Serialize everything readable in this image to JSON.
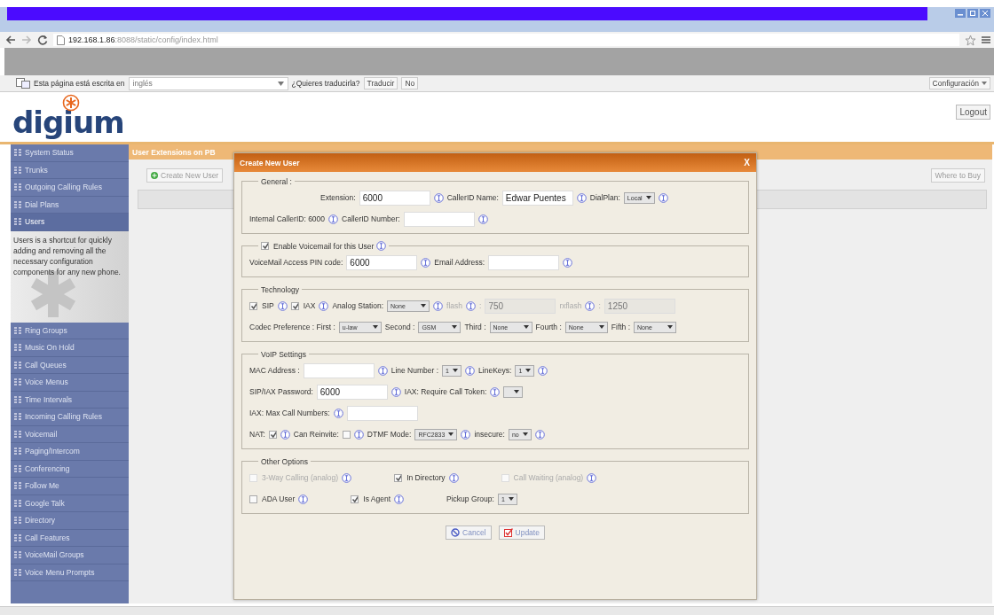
{
  "browser": {
    "url_host": "192.168.1.86",
    "url_rest": ":8088/static/config/index.html"
  },
  "translate_bar": {
    "prefix": "Esta página está escrita en",
    "language": "inglés",
    "question": "¿Quieres traducirla?",
    "buttons": [
      "Traducir",
      "No"
    ],
    "settings": "Configuración"
  },
  "header": {
    "logo": "digium",
    "logout": "Logout"
  },
  "sidebar": {
    "items_top": [
      {
        "label": "System Status",
        "selected": false
      },
      {
        "label": "Trunks",
        "selected": false
      },
      {
        "label": "Outgoing Calling Rules",
        "selected": false
      },
      {
        "label": "Dial Plans",
        "selected": false
      },
      {
        "label": "Users",
        "selected": true
      }
    ],
    "description": "Users is a shortcut for quickly adding and removing all the necessary configuration components for any new phone.",
    "items_bottom": [
      {
        "label": "Ring Groups",
        "selected": false
      },
      {
        "label": "Music On Hold",
        "selected": false
      },
      {
        "label": "Call Queues",
        "selected": false
      },
      {
        "label": "Voice Menus",
        "selected": false
      },
      {
        "label": "Time Intervals",
        "selected": false
      },
      {
        "label": "Incoming Calling Rules",
        "selected": false
      },
      {
        "label": "Voicemail",
        "selected": false
      },
      {
        "label": "Paging/Intercom",
        "selected": false
      },
      {
        "label": "Conferencing",
        "selected": false
      },
      {
        "label": "Follow Me",
        "selected": false
      },
      {
        "label": "Google Talk",
        "selected": false
      },
      {
        "label": "Directory",
        "selected": false
      },
      {
        "label": "Call Features",
        "selected": false
      },
      {
        "label": "VoiceMail Groups",
        "selected": false
      },
      {
        "label": "Voice Menu Prompts",
        "selected": false
      }
    ]
  },
  "page": {
    "title": "User Extensions on PB",
    "create_button": "Create New User",
    "where_button": "Where to Buy"
  },
  "dialog": {
    "title": "Create New User",
    "close": "X",
    "sections": [
      {
        "legend": [
          {
            "kind": "label",
            "text": "General :"
          }
        ],
        "rows": [
          {
            "items": [
              {
                "kind": "label",
                "text": "Extension:"
              },
              {
                "kind": "input",
                "value": "6000",
                "disabled": false
              },
              {
                "kind": "info"
              },
              {
                "kind": "label",
                "text": "CallerID Name:"
              },
              {
                "kind": "input",
                "value": "Edwar Puentes",
                "disabled": false
              },
              {
                "kind": "info"
              },
              {
                "kind": "label",
                "text": "DialPlan:"
              },
              {
                "kind": "select",
                "value": "Local"
              },
              {
                "kind": "info"
              }
            ]
          },
          {
            "items": [
              {
                "kind": "label",
                "text": "Internal CallerID: 6000"
              },
              {
                "kind": "info"
              },
              {
                "kind": "label",
                "text": "CallerID Number:"
              },
              {
                "kind": "input",
                "disabled": false
              },
              {
                "kind": "info"
              }
            ]
          }
        ]
      },
      {
        "legend": [
          {
            "kind": "checkbox",
            "label": "Enable Voicemail for this User",
            "checked": true,
            "disabled": false
          },
          {
            "kind": "info"
          }
        ],
        "rows": [
          {
            "items": [
              {
                "kind": "label",
                "text": "VoiceMail Access PIN code:"
              },
              {
                "kind": "input",
                "value": "6000",
                "disabled": false
              },
              {
                "kind": "info"
              },
              {
                "kind": "label",
                "text": "Email Address:"
              },
              {
                "kind": "input",
                "disabled": false
              },
              {
                "kind": "info"
              }
            ]
          }
        ]
      },
      {
        "legend": [
          {
            "kind": "label",
            "text": "Technology"
          }
        ],
        "rows": [
          {
            "items": [
              {
                "kind": "checkbox",
                "label": "SIP",
                "checked": true,
                "disabled": false
              },
              {
                "kind": "info"
              },
              {
                "kind": "checkbox",
                "label": "IAX",
                "checked": true,
                "disabled": false
              },
              {
                "kind": "info"
              },
              {
                "kind": "label",
                "text": "Analog Station:"
              },
              {
                "kind": "select",
                "value": "None"
              },
              {
                "kind": "info"
              },
              {
                "kind": "hint",
                "text": "flash"
              },
              {
                "kind": "info"
              },
              {
                "kind": "hint",
                "text": ":"
              },
              {
                "kind": "input",
                "value": "750",
                "disabled": true
              },
              {
                "kind": "hint",
                "text": "rxflash"
              },
              {
                "kind": "info"
              },
              {
                "kind": "hint",
                "text": ":"
              },
              {
                "kind": "input",
                "value": "1250",
                "disabled": true
              }
            ]
          },
          {
            "items": [
              {
                "kind": "label",
                "text": "Codec Preference : First :"
              },
              {
                "kind": "select",
                "value": "u-law"
              },
              {
                "kind": "label",
                "text": "Second :"
              },
              {
                "kind": "select",
                "value": "GSM"
              },
              {
                "kind": "label",
                "text": "Third :"
              },
              {
                "kind": "select",
                "value": "None"
              },
              {
                "kind": "label",
                "text": "Fourth :"
              },
              {
                "kind": "select",
                "value": "None"
              },
              {
                "kind": "label",
                "text": "Fifth :"
              },
              {
                "kind": "select",
                "value": "None"
              }
            ]
          }
        ]
      },
      {
        "legend": [
          {
            "kind": "label",
            "text": "VoIP Settings"
          }
        ],
        "rows": [
          {
            "items": [
              {
                "kind": "label",
                "text": "MAC Address :"
              },
              {
                "kind": "input",
                "disabled": false
              },
              {
                "kind": "info"
              },
              {
                "kind": "label",
                "text": "Line Number :"
              },
              {
                "kind": "select",
                "value": "1"
              },
              {
                "kind": "info"
              },
              {
                "kind": "label",
                "text": "LineKeys:"
              },
              {
                "kind": "select",
                "value": "1"
              },
              {
                "kind": "info"
              }
            ]
          },
          {
            "items": [
              {
                "kind": "label",
                "text": "SIP/IAX Password:"
              },
              {
                "kind": "input",
                "value": "6000",
                "disabled": false
              },
              {
                "kind": "info"
              },
              {
                "kind": "label",
                "text": "IAX: Require Call Token:"
              },
              {
                "kind": "info"
              },
              {
                "kind": "select"
              }
            ]
          },
          {
            "items": [
              {
                "kind": "label",
                "text": "IAX: Max Call Numbers:"
              },
              {
                "kind": "info"
              },
              {
                "kind": "input",
                "disabled": false
              }
            ]
          },
          {
            "items": [
              {
                "kind": "label",
                "text": "NAT:"
              },
              {
                "kind": "checkbox",
                "checked": true,
                "disabled": false
              },
              {
                "kind": "info"
              },
              {
                "kind": "label",
                "text": "Can Reinvite:"
              },
              {
                "kind": "checkbox",
                "checked": false,
                "disabled": false
              },
              {
                "kind": "info"
              },
              {
                "kind": "label",
                "text": "DTMF Mode:"
              },
              {
                "kind": "select",
                "value": "RFC2833"
              },
              {
                "kind": "info"
              },
              {
                "kind": "label",
                "text": "insecure:"
              },
              {
                "kind": "select",
                "value": "no"
              },
              {
                "kind": "info"
              }
            ]
          }
        ]
      },
      {
        "legend": [
          {
            "kind": "label",
            "text": "Other Options"
          }
        ],
        "rows": [
          {
            "items": [
              {
                "kind": "checkbox",
                "label": "3-Way Calling (analog)",
                "checked": false,
                "disabled": true
              },
              {
                "kind": "info"
              },
              {
                "kind": "gap"
              },
              {
                "kind": "checkbox",
                "label": "In Directory",
                "checked": true,
                "disabled": false
              },
              {
                "kind": "info"
              },
              {
                "kind": "gap"
              },
              {
                "kind": "checkbox",
                "label": "Call Waiting (analog)",
                "checked": false,
                "disabled": true
              },
              {
                "kind": "info"
              }
            ]
          },
          {
            "items": [
              {
                "kind": "checkbox",
                "label": "ADA User",
                "checked": false,
                "disabled": false
              },
              {
                "kind": "info"
              },
              {
                "kind": "gap"
              },
              {
                "kind": "checkbox",
                "label": "Is Agent",
                "checked": true,
                "disabled": false
              },
              {
                "kind": "info"
              },
              {
                "kind": "gap"
              },
              {
                "kind": "label",
                "text": "Pickup Group:"
              },
              {
                "kind": "select",
                "value": "1"
              }
            ]
          }
        ]
      }
    ],
    "buttons": [
      {
        "kind": "cancel",
        "label": "Cancel"
      },
      {
        "kind": "update",
        "label": "Update"
      }
    ]
  }
}
